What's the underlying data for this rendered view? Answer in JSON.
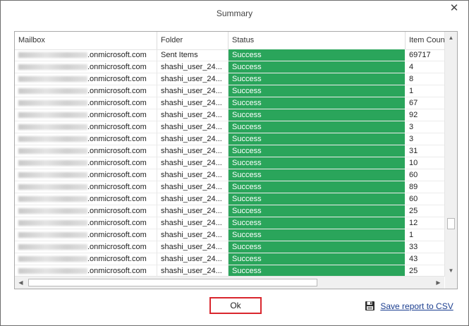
{
  "dialog": {
    "title": "Summary"
  },
  "table": {
    "columns": [
      "Mailbox",
      "Folder",
      "Status",
      "Item Count"
    ],
    "rows": [
      {
        "mailbox": ".onmicrosoft.com",
        "folder": "Sent Items",
        "status": "Success",
        "count": "69717"
      },
      {
        "mailbox": ".onmicrosoft.com",
        "folder": "shashi_user_24...",
        "status": "Success",
        "count": "4"
      },
      {
        "mailbox": ".onmicrosoft.com",
        "folder": "shashi_user_24...",
        "status": "Success",
        "count": "8"
      },
      {
        "mailbox": ".onmicrosoft.com",
        "folder": "shashi_user_24...",
        "status": "Success",
        "count": "1"
      },
      {
        "mailbox": ".onmicrosoft.com",
        "folder": "shashi_user_24...",
        "status": "Success",
        "count": "67"
      },
      {
        "mailbox": ".onmicrosoft.com",
        "folder": "shashi_user_24...",
        "status": "Success",
        "count": "92"
      },
      {
        "mailbox": ".onmicrosoft.com",
        "folder": "shashi_user_24...",
        "status": "Success",
        "count": "3"
      },
      {
        "mailbox": ".onmicrosoft.com",
        "folder": "shashi_user_24...",
        "status": "Success",
        "count": "3"
      },
      {
        "mailbox": ".onmicrosoft.com",
        "folder": "shashi_user_24...",
        "status": "Success",
        "count": "31"
      },
      {
        "mailbox": ".onmicrosoft.com",
        "folder": "shashi_user_24...",
        "status": "Success",
        "count": "10"
      },
      {
        "mailbox": ".onmicrosoft.com",
        "folder": "shashi_user_24...",
        "status": "Success",
        "count": "60"
      },
      {
        "mailbox": ".onmicrosoft.com",
        "folder": "shashi_user_24...",
        "status": "Success",
        "count": "89"
      },
      {
        "mailbox": ".onmicrosoft.com",
        "folder": "shashi_user_24...",
        "status": "Success",
        "count": "60"
      },
      {
        "mailbox": ".onmicrosoft.com",
        "folder": "shashi_user_24...",
        "status": "Success",
        "count": "25"
      },
      {
        "mailbox": ".onmicrosoft.com",
        "folder": "shashi_user_24...",
        "status": "Success",
        "count": "12"
      },
      {
        "mailbox": ".onmicrosoft.com",
        "folder": "shashi_user_24...",
        "status": "Success",
        "count": "1"
      },
      {
        "mailbox": ".onmicrosoft.com",
        "folder": "shashi_user_24...",
        "status": "Success",
        "count": "33"
      },
      {
        "mailbox": ".onmicrosoft.com",
        "folder": "shashi_user_24...",
        "status": "Success",
        "count": "43"
      },
      {
        "mailbox": ".onmicrosoft.com",
        "folder": "shashi_user_24...",
        "status": "Success",
        "count": "25"
      }
    ]
  },
  "buttons": {
    "ok_label": "Ok",
    "save_label": "Save report to CSV"
  },
  "icons": {
    "close": "close-icon",
    "save": "floppy-disk-icon",
    "scroll_up": "arrow-up-icon",
    "scroll_down": "arrow-down-icon",
    "scroll_left": "arrow-left-icon",
    "scroll_right": "arrow-right-icon"
  },
  "colors": {
    "success": "#2aa55b",
    "highlight_border": "#d9272e",
    "link": "#1a3d8f"
  }
}
